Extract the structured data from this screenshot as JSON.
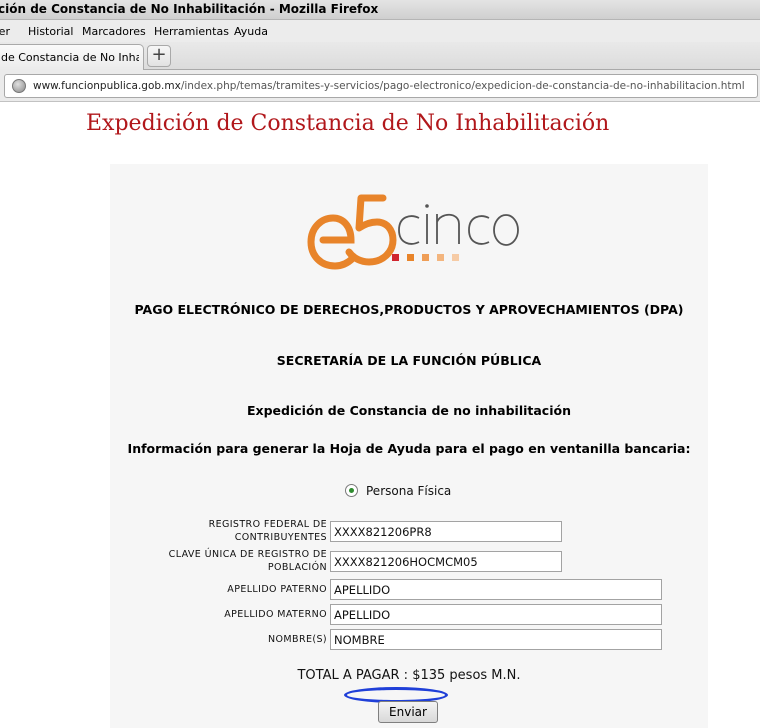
{
  "window": {
    "title": "ción de Constancia de No Inhabilitación - Mozilla Firefox"
  },
  "menubar": {
    "items": [
      "Ver",
      "Historial",
      "Marcadores",
      "Herramientas",
      "Ayuda"
    ]
  },
  "tabs": {
    "active_label": "de Constancia de No Inhabi...",
    "new_tab_label": "+"
  },
  "navbar": {
    "url_host": "www.funcionpublica.gob.mx",
    "url_path": "/index.php/temas/tramites-y-servicios/pago-electronico/expedicion-de-constancia-de-no-inhabilitacion.html"
  },
  "page": {
    "heading": "Expedición de Constancia de No Inhabilitación",
    "logo_text": "e5cinco",
    "line1": "PAGO ELECTRÓNICO DE DERECHOS,PRODUCTOS Y APROVECHAMIENTOS (DPA)",
    "line2": "SECRETARÍA DE LA FUNCIÓN PÚBLICA",
    "line3": "Expedición de Constancia de no inhabilitación",
    "line4": "Información para generar la Hoja de Ayuda para el pago en ventanilla bancaria:",
    "radio_label": "Persona Física",
    "fields": {
      "rfc_label_1": "REGISTRO FEDERAL DE",
      "rfc_label_2": "CONTRIBUYENTES",
      "rfc_value": "XXXX821206PR8",
      "curp_label_1": "CLAVE ÚNICA DE REGISTRO DE",
      "curp_label_2": "POBLACIÓN",
      "curp_value": "XXXX821206HOCMCM05",
      "paterno_label": "APELLIDO PATERNO",
      "paterno_value": "APELLIDO",
      "materno_label": "APELLIDO MATERNO",
      "materno_value": "APELLIDO",
      "nombre_label": "NOMBRE(S)",
      "nombre_value": "NOMBRE"
    },
    "total": "TOTAL A PAGAR : $135 pesos M.N.",
    "submit_label": "Enviar"
  },
  "colors": {
    "heading": "#b1171b",
    "logo_orange": "#e8842a",
    "logo_gray": "#555555",
    "annotation_oval": "#1f3fd8"
  },
  "icons": [
    "globe-icon",
    "radio-selected-icon"
  ]
}
